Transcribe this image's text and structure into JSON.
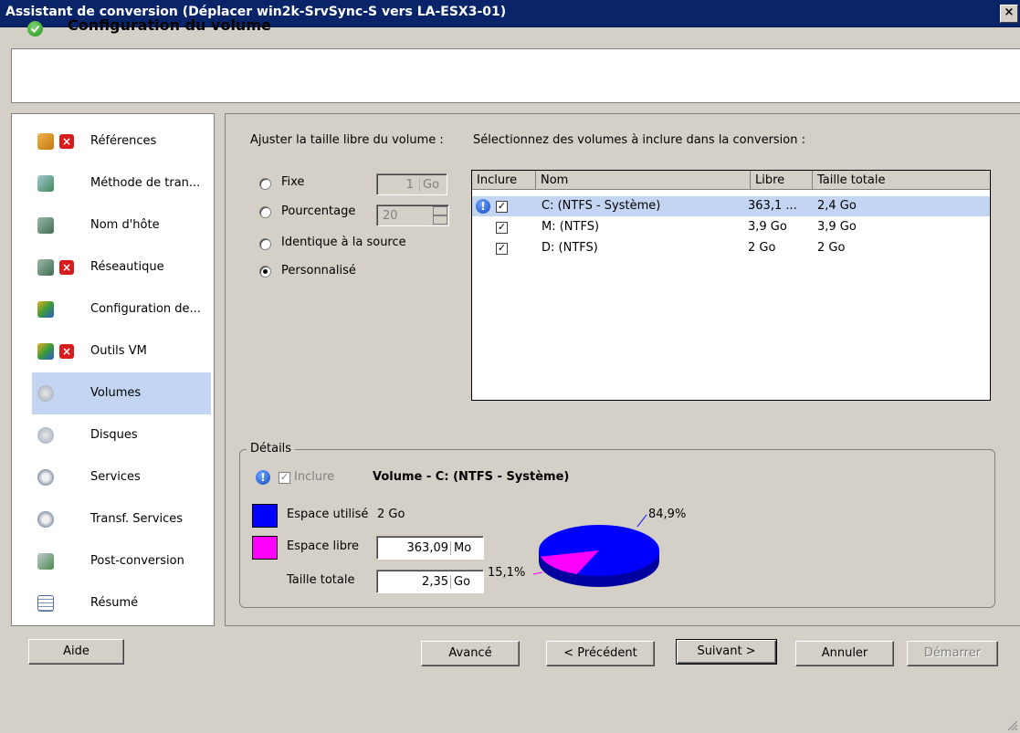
{
  "window": {
    "title": "Assistant de conversion (Déplacer win2k-SrvSync-S vers LA-ESX3-01)",
    "close_label": "×"
  },
  "header": {
    "title": "Configuration du volume",
    "icon": "check-circle-icon"
  },
  "sidebar": {
    "items": [
      {
        "label": "Références",
        "icon": "key-person-icon",
        "error": true
      },
      {
        "label": "Méthode de tran...",
        "icon": "disk-green-icon",
        "error": false
      },
      {
        "label": "Nom d'hôte",
        "icon": "network-host-icon",
        "error": false
      },
      {
        "label": "Réseautique",
        "icon": "network-host-icon",
        "error": true
      },
      {
        "label": "Configuration de...",
        "icon": "config-icon",
        "error": false
      },
      {
        "label": "Outils VM",
        "icon": "config-icon",
        "error": true
      },
      {
        "label": "Volumes",
        "icon": "volume-icon",
        "error": false,
        "selected": true
      },
      {
        "label": "Disques",
        "icon": "volume-icon",
        "error": false
      },
      {
        "label": "Services",
        "icon": "gear-icon",
        "error": false
      },
      {
        "label": "Transf. Services",
        "icon": "gear-icon",
        "error": false
      },
      {
        "label": "Post-conversion",
        "icon": "postconv-icon",
        "error": false
      },
      {
        "label": "Résumé",
        "icon": "summary-icon",
        "error": false
      }
    ],
    "error_glyph": "×"
  },
  "size_options": {
    "heading": "Ajuster la taille libre du volume :",
    "fixe": "Fixe",
    "fixe_value": "1",
    "fixe_unit": "Go",
    "pourcentage": "Pourcentage",
    "pourcentage_value": "20",
    "identique": "Identique à la source",
    "personnalise": "Personnalisé",
    "selected": "personnalise"
  },
  "volumes": {
    "heading": "Sélectionnez des volumes à inclure dans la conversion :",
    "columns": [
      "Inclure",
      "Nom",
      "Libre",
      "Taille totale"
    ],
    "rows": [
      {
        "included": true,
        "warning": true,
        "name": "C: (NTFS - Système)",
        "free": "363,1 ...",
        "total": "2,4 Go",
        "selected": true
      },
      {
        "included": true,
        "warning": false,
        "name": "M: (NTFS)",
        "free": "3,9 Go",
        "total": "3,9 Go"
      },
      {
        "included": true,
        "warning": false,
        "name": "D: (NTFS)",
        "free": "2 Go",
        "total": "2 Go"
      }
    ],
    "check_glyph": "✓",
    "info_glyph": "!"
  },
  "details": {
    "legend": "Détails",
    "include_label": "Inclure",
    "volume_title": "Volume - C: (NTFS - Système)",
    "used_label": "Espace utilisé",
    "used_value": "2 Go",
    "free_label": "Espace libre",
    "free_value": "363,09",
    "free_unit": "Mo",
    "total_label": "Taille totale",
    "total_value": "2,35",
    "total_unit": "Go",
    "used_color": "#0000ff",
    "free_color": "#ff00ff",
    "pie_used_pct": "84,9%",
    "pie_free_pct": "15,1%",
    "pie_used_fraction": 0.849
  },
  "buttons": {
    "aide": "Aide",
    "avance": "Avancé",
    "precedent": "< Précédent",
    "suivant": "Suivant >",
    "annuler": "Annuler",
    "demarrer": "Démarrer"
  }
}
